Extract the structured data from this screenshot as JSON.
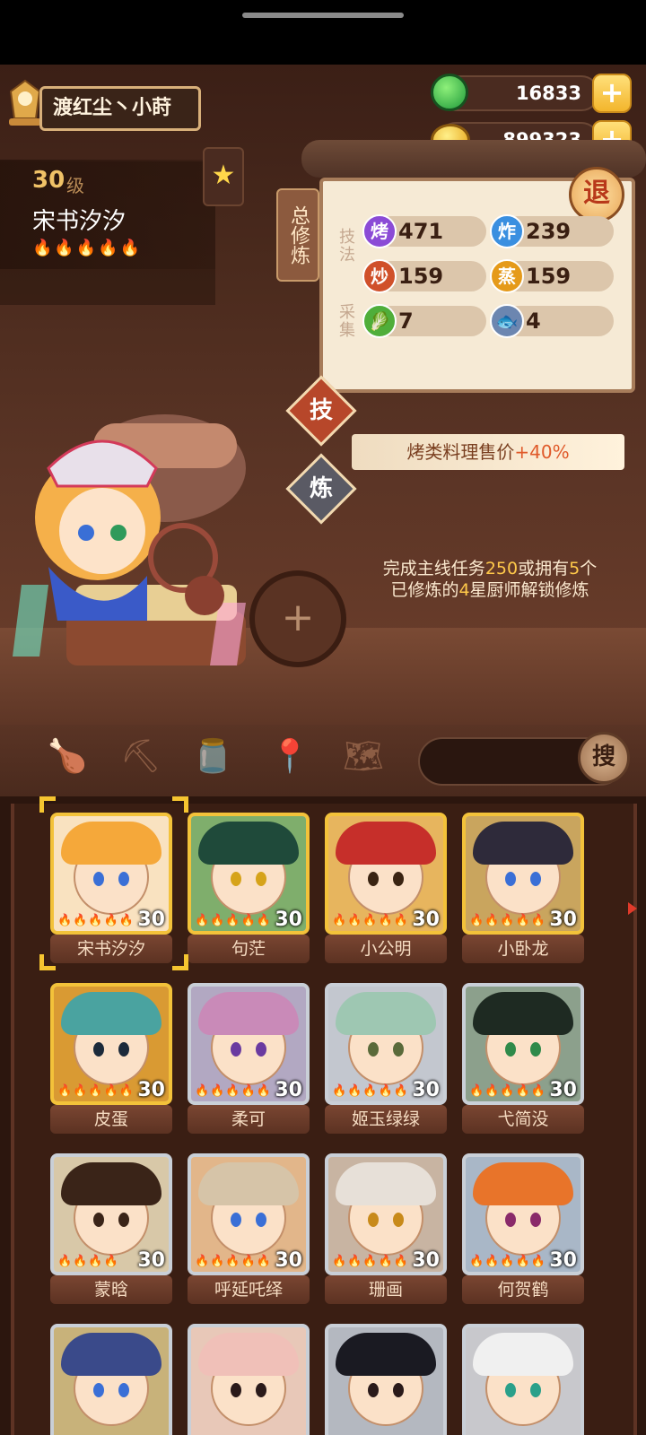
{
  "player": {
    "name": "渡红尘丶小莳"
  },
  "currency": {
    "jade": "16833",
    "coins": "899323"
  },
  "chef": {
    "level": "30",
    "level_unit": "级",
    "name": "宋书汐汐",
    "flames": "🔥🔥🔥🔥🔥"
  },
  "panel": {
    "total_label": "总修炼",
    "exit_label": "退",
    "skills_label": "技法",
    "gather_label": "采集",
    "stats": [
      {
        "icon": "烤",
        "value": "471",
        "color": "#8b4bd6"
      },
      {
        "icon": "炸",
        "value": "239",
        "color": "#3a8fe0"
      },
      {
        "icon": "炒",
        "value": "159",
        "color": "#d0502a"
      },
      {
        "icon": "蒸",
        "value": "159",
        "color": "#e59a1a"
      },
      {
        "icon": "🥬",
        "value": "7",
        "color": "#4fae3a"
      },
      {
        "icon": "🐟",
        "value": "4",
        "color": "#6c86b0"
      }
    ],
    "skill_btn": "技",
    "refine_btn": "炼",
    "bonus_prefix": "烤类料理售价",
    "bonus_value": "+40%",
    "hint": {
      "p1": "完成主线任务",
      "n1": "250",
      "p2": "或拥有",
      "n2": "5",
      "p3": "个",
      "p4": "已修炼的",
      "n3": "4",
      "p5": "星厨师解锁修炼"
    },
    "add_label": "+"
  },
  "toolbar": {
    "search_label": "搜"
  },
  "chefs": [
    {
      "name": "宋书汐汐",
      "level": "30",
      "flames": "🔥🔥🔥🔥🔥",
      "frame": "gold",
      "hair": "#f5a83a",
      "bg": "#f9e2c0",
      "eye": "#3a6fd6"
    },
    {
      "name": "句茫",
      "level": "30",
      "flames": "🔥🔥🔥🔥🔥",
      "frame": "gold",
      "hair": "#1f4a3a",
      "bg": "#7fae6c",
      "eye": "#d6a31a"
    },
    {
      "name": "小公明",
      "level": "30",
      "flames": "🔥🔥🔥🔥🔥",
      "frame": "gold",
      "hair": "#c62f2a",
      "bg": "#e7b55e",
      "eye": "#3a2412"
    },
    {
      "name": "小卧龙",
      "level": "30",
      "flames": "🔥🔥🔥🔥🔥",
      "frame": "gold",
      "hair": "#2e2a3a",
      "bg": "#c9a55e",
      "eye": "#3a6fd6"
    },
    {
      "name": "皮蛋",
      "level": "30",
      "flames": "🔥🔥🔥🔥🔥",
      "frame": "gold",
      "hair": "#4aa3a0",
      "bg": "#d99a33",
      "eye": "#1c2a3a"
    },
    {
      "name": "柔可",
      "level": "30",
      "flames": "🔥🔥🔥🔥🔥",
      "frame": "silver",
      "hair": "#c98ab8",
      "bg": "#b2a8c2",
      "eye": "#6a3aa0"
    },
    {
      "name": "姬玉绿绿",
      "level": "30",
      "flames": "🔥🔥🔥🔥🔥",
      "frame": "silver",
      "hair": "#9ec7b2",
      "bg": "#c3c7cf",
      "eye": "#5a6a3a"
    },
    {
      "name": "弋简没",
      "level": "30",
      "flames": "🔥🔥🔥🔥🔥",
      "frame": "silver",
      "hair": "#1e2a22",
      "bg": "#8ca08c",
      "eye": "#2f8a4a"
    },
    {
      "name": "蒙晗",
      "level": "30",
      "flames": "🔥🔥🔥🔥",
      "frame": "silver",
      "hair": "#3a2418",
      "bg": "#d8c8a8",
      "eye": "#3a2418"
    },
    {
      "name": "呼延吒绎",
      "level": "30",
      "flames": "🔥🔥🔥🔥🔥",
      "frame": "silver",
      "hair": "#d6c4a8",
      "bg": "#e2b68a",
      "eye": "#3a6fd6"
    },
    {
      "name": "珊画",
      "level": "30",
      "flames": "🔥🔥🔥🔥🔥",
      "frame": "silver",
      "hair": "#e7e0d8",
      "bg": "#c8b4a2",
      "eye": "#c88a1a"
    },
    {
      "name": "何贺鹤",
      "level": "30",
      "flames": "🔥🔥🔥🔥🔥",
      "frame": "silver",
      "hair": "#e8742a",
      "bg": "#a9b7c7",
      "eye": "#8a2a6a"
    },
    {
      "name": "",
      "level": "",
      "flames": "",
      "frame": "silver",
      "hair": "#3a4a8a",
      "bg": "#c8b27a",
      "eye": "#3a6fd6"
    },
    {
      "name": "",
      "level": "",
      "flames": "",
      "frame": "silver",
      "hair": "#f0c0b8",
      "bg": "#e8c8b8",
      "eye": "#2a1a1a"
    },
    {
      "name": "",
      "level": "",
      "flames": "",
      "frame": "silver",
      "hair": "#1a1a22",
      "bg": "#b4b8c0",
      "eye": "#2a1a1a"
    },
    {
      "name": "",
      "level": "",
      "flames": "",
      "frame": "silver",
      "hair": "#f0f0f0",
      "bg": "#c8c8cc",
      "eye": "#2aa08a"
    }
  ]
}
